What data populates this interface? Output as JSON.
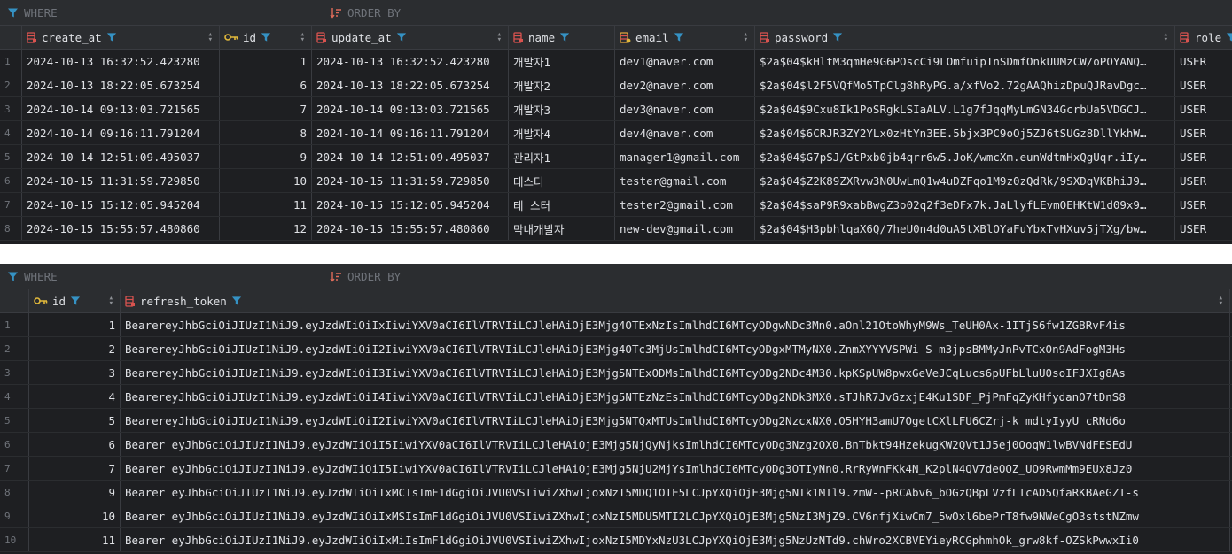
{
  "colors": {
    "background": "#1e1f22",
    "header": "#2b2d30",
    "filter_icon": "#3592c4",
    "table_icon": "#d9534f",
    "key_icon": "#e2b93b",
    "text": "#dfe1e5",
    "muted": "#6f737a"
  },
  "table1": {
    "filter": {
      "where_label": "WHERE",
      "order_label": "ORDER BY"
    },
    "columns": [
      {
        "label": "create_at",
        "icon": "column-icon"
      },
      {
        "label": "id",
        "icon": "primary-key-icon"
      },
      {
        "label": "update_at",
        "icon": "column-icon"
      },
      {
        "label": "name",
        "icon": "column-icon"
      },
      {
        "label": "email",
        "icon": "unique-column-icon"
      },
      {
        "label": "password",
        "icon": "column-icon"
      },
      {
        "label": "role",
        "icon": "column-icon"
      }
    ],
    "rows": [
      {
        "num": "1",
        "create_at": "2024-10-13 16:32:52.423280",
        "id": "1",
        "update_at": "2024-10-13 16:32:52.423280",
        "name": "개발자1",
        "email": "dev1@naver.com",
        "password": "$2a$04$kHltM3qmHe9G6POscCi9LOmfuipTnSDmfOnkUUMzCW/oPOYANQ…",
        "role": "USER"
      },
      {
        "num": "2",
        "create_at": "2024-10-13 18:22:05.673254",
        "id": "6",
        "update_at": "2024-10-13 18:22:05.673254",
        "name": "개발자2",
        "email": "dev2@naver.com",
        "password": "$2a$04$l2F5VQfMo5TpClg8hRyPG.a/xfVo2.72gAAQhizDpuQJRavDgc…",
        "role": "USER"
      },
      {
        "num": "3",
        "create_at": "2024-10-14 09:13:03.721565",
        "id": "7",
        "update_at": "2024-10-14 09:13:03.721565",
        "name": "개발자3",
        "email": "dev3@naver.com",
        "password": "$2a$04$9Cxu8Ik1PoSRgkLSIaALV.L1g7fJqqMyLmGN34GcrbUa5VDGCJ…",
        "role": "USER"
      },
      {
        "num": "4",
        "create_at": "2024-10-14 09:16:11.791204",
        "id": "8",
        "update_at": "2024-10-14 09:16:11.791204",
        "name": "개발자4",
        "email": "dev4@naver.com",
        "password": "$2a$04$6CRJR3ZY2YLx0zHtYn3EE.5bjx3PC9oOj5ZJ6tSUGz8DllYkhW…",
        "role": "USER"
      },
      {
        "num": "5",
        "create_at": "2024-10-14 12:51:09.495037",
        "id": "9",
        "update_at": "2024-10-14 12:51:09.495037",
        "name": "관리자1",
        "email": "manager1@gmail.com",
        "password": "$2a$04$G7pSJ/GtPxb0jb4qrr6w5.JoK/wmcXm.eunWdtmHxQgUqr.iIy…",
        "role": "USER"
      },
      {
        "num": "6",
        "create_at": "2024-10-15 11:31:59.729850",
        "id": "10",
        "update_at": "2024-10-15 11:31:59.729850",
        "name": "테스터",
        "email": "tester@gmail.com",
        "password": "$2a$04$Z2K89ZXRvw3N0UwLmQ1w4uDZFqo1M9z0zQdRk/9SXDqVKBhiJ9…",
        "role": "USER"
      },
      {
        "num": "7",
        "create_at": "2024-10-15 15:12:05.945204",
        "id": "11",
        "update_at": "2024-10-15 15:12:05.945204",
        "name": "테 스터",
        "email": "tester2@gmail.com",
        "password": "$2a$04$saP9R9xabBwgZ3o02q2f3eDFx7k.JaLlyfLEvmOEHKtW1d09x9…",
        "role": "USER"
      },
      {
        "num": "8",
        "create_at": "2024-10-15 15:55:57.480860",
        "id": "12",
        "update_at": "2024-10-15 15:55:57.480860",
        "name": "막내개발자",
        "email": "new-dev@gmail.com",
        "password": "$2a$04$H3pbhlqaX6Q/7heU0n4d0uA5tXBlOYaFuYbxTvHXuv5jTXg/bw…",
        "role": "USER"
      }
    ]
  },
  "table2": {
    "filter": {
      "where_label": "WHERE",
      "order_label": "ORDER BY"
    },
    "columns": [
      {
        "label": "id",
        "icon": "primary-key-icon"
      },
      {
        "label": "refresh_token",
        "icon": "column-icon"
      }
    ],
    "rows": [
      {
        "num": "1",
        "id": "1",
        "refresh_token": "BearereyJhbGciOiJIUzI1NiJ9.eyJzdWIiOiIxIiwiYXV0aCI6IlVTRVIiLCJleHAiOjE3Mjg4OTExNzIsImlhdCI6MTcyODgwNDc3Mn0.aOnl21OtoWhyM9Ws_TeUH0Ax-1ITjS6fw1ZGBRvF4is"
      },
      {
        "num": "2",
        "id": "2",
        "refresh_token": "BearereyJhbGciOiJIUzI1NiJ9.eyJzdWIiOiI2IiwiYXV0aCI6IlVTRVIiLCJleHAiOjE3Mjg4OTc3MjUsImlhdCI6MTcyODgxMTMyNX0.ZnmXYYYVSPWi-S-m3jpsBMMyJnPvTCxOn9AdFogM3Hs"
      },
      {
        "num": "3",
        "id": "3",
        "refresh_token": "BearereyJhbGciOiJIUzI1NiJ9.eyJzdWIiOiI3IiwiYXV0aCI6IlVTRVIiLCJleHAiOjE3Mjg5NTExODMsImlhdCI6MTcyODg2NDc4M30.kpKSpUW8pwxGeVeJCqLucs6pUFbLluU0soIFJXIg8As"
      },
      {
        "num": "4",
        "id": "4",
        "refresh_token": "BearereyJhbGciOiJIUzI1NiJ9.eyJzdWIiOiI4IiwiYXV0aCI6IlVTRVIiLCJleHAiOjE3Mjg5NTEzNzEsImlhdCI6MTcyODg2NDk3MX0.sTJhR7JvGzxjE4Ku1SDF_PjPmFqZyKHfydanO7tDnS8"
      },
      {
        "num": "5",
        "id": "5",
        "refresh_token": "BearereyJhbGciOiJIUzI1NiJ9.eyJzdWIiOiI2IiwiYXV0aCI6IlVTRVIiLCJleHAiOjE3Mjg5NTQxMTUsImlhdCI6MTcyODg2NzcxNX0.O5HYH3amU7OgetCXlLFU6CZrj-k_mdtyIyyU_cRNd6o"
      },
      {
        "num": "6",
        "id": "6",
        "refresh_token": "Bearer eyJhbGciOiJIUzI1NiJ9.eyJzdWIiOiI5IiwiYXV0aCI6IlVTRVIiLCJleHAiOjE3Mjg5NjQyNjksImlhdCI6MTcyODg3Nzg2OX0.BnTbkt94HzekugKW2QVt1J5ej0OoqW1lwBVNdFESEdU"
      },
      {
        "num": "7",
        "id": "7",
        "refresh_token": "Bearer eyJhbGciOiJIUzI1NiJ9.eyJzdWIiOiI5IiwiYXV0aCI6IlVTRVIiLCJleHAiOjE3Mjg5NjU2MjYsImlhdCI6MTcyODg3OTIyNn0.RrRyWnFKk4N_K2plN4QV7deOOZ_UO9RwmMm9EUx8Jz0"
      },
      {
        "num": "8",
        "id": "9",
        "refresh_token": "Bearer eyJhbGciOiJIUzI1NiJ9.eyJzdWIiOiIxMCIsImF1dGgiOiJVU0VSIiwiZXhwIjoxNzI5MDQ1OTE5LCJpYXQiOjE3Mjg5NTk1MTl9.zmW--pRCAbv6_bOGzQBpLVzfLIcAD5QfaRKBAeGZT-s"
      },
      {
        "num": "9",
        "id": "10",
        "refresh_token": "Bearer eyJhbGciOiJIUzI1NiJ9.eyJzdWIiOiIxMSIsImF1dGgiOiJVU0VSIiwiZXhwIjoxNzI5MDU5MTI2LCJpYXQiOjE3Mjg5NzI3MjZ9.CV6nfjXiwCm7_5wOxl6bePrT8fw9NWeCgO3ststNZmw"
      },
      {
        "num": "10",
        "id": "11",
        "refresh_token": "Bearer eyJhbGciOiJIUzI1NiJ9.eyJzdWIiOiIxMiIsImF1dGgiOiJVU0VSIiwiZXhwIjoxNzI5MDYxNzU3LCJpYXQiOjE3Mjg5NzUzNTd9.chWro2XCBVEYieyRCGphmhOk_grw8kf-OZSkPwwxIi0"
      }
    ]
  }
}
